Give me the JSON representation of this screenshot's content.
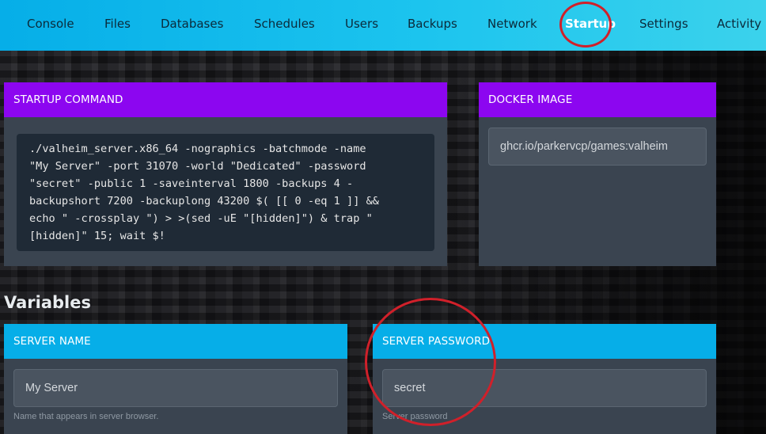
{
  "nav": {
    "items": [
      {
        "label": "Console",
        "active": false
      },
      {
        "label": "Files",
        "active": false
      },
      {
        "label": "Databases",
        "active": false
      },
      {
        "label": "Schedules",
        "active": false
      },
      {
        "label": "Users",
        "active": false
      },
      {
        "label": "Backups",
        "active": false
      },
      {
        "label": "Network",
        "active": false
      },
      {
        "label": "Startup",
        "active": true
      },
      {
        "label": "Settings",
        "active": false
      },
      {
        "label": "Activity",
        "active": false
      }
    ]
  },
  "startup": {
    "header": "STARTUP COMMAND",
    "command_lines": [
      "./valheim_server.x86_64 -nographics -batchmode -name",
      "\"My Server\" -port 31070 -world \"Dedicated\" -password",
      "\"secret\" -public 1 -saveinterval 1800 -backups 4 -",
      "backupshort 7200 -backuplong 43200 $( [[ 0 -eq 1 ]] &&",
      "echo \" -crossplay \") > >(sed -uE \"[hidden]\") & trap \"",
      "[hidden]\" 15; wait $!"
    ]
  },
  "docker": {
    "header": "DOCKER IMAGE",
    "value": "ghcr.io/parkervcp/games:valheim"
  },
  "variables": {
    "title": "Variables",
    "server_name": {
      "header": "SERVER NAME",
      "value": "My Server",
      "help": "Name that appears in server browser."
    },
    "server_password": {
      "header": "SERVER PASSWORD",
      "value": "secret",
      "help": "Server password"
    }
  },
  "colors": {
    "nav_bg": "#06aee8",
    "purple_header": "#8c06f0",
    "blue_header": "#06aee8",
    "panel_bg": "#3a4450",
    "annotation": "#d0202a"
  }
}
